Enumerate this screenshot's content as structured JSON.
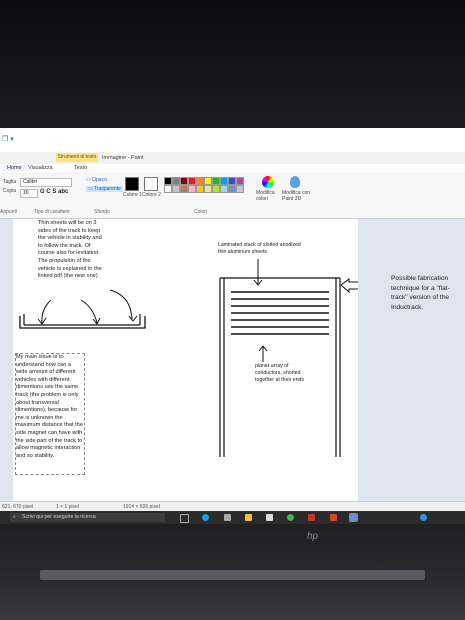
{
  "app": {
    "context_tab": "Strumenti di testo",
    "window_title": "Immagine - Paint",
    "tabs": [
      "Home",
      "Visualizza",
      "Testo"
    ]
  },
  "ribbon": {
    "font_name": "Calibri",
    "font_size": "10",
    "style_labels": "G C S abc",
    "opaque": "Opaco",
    "transparent": "Trasparente",
    "left_labels": [
      "Taglia",
      "Copia"
    ],
    "color1": "Colore 1",
    "color2": "Colore 2",
    "edit_colors": "Modifica colori",
    "paint3d": "Modifica con Paint 3D",
    "group_labels": [
      "Appunti",
      "Tipo di carattere",
      "Sfondo",
      "Colori"
    ],
    "palette": [
      "#000000",
      "#7f7f7f",
      "#880015",
      "#ed1c24",
      "#ff7f27",
      "#fff200",
      "#22b14c",
      "#00a2e8",
      "#3f48cc",
      "#a349a4",
      "#ffffff",
      "#c3c3c3",
      "#b97a57",
      "#ffaec9",
      "#ffc90e",
      "#efe4b0",
      "#b5e61d",
      "#99d9ea",
      "#7092be",
      "#c8bfe7"
    ]
  },
  "canvas": {
    "left_note": "Thin sheets will be on 3 sides of the track to keep the vehicle in stability and to follow the track. Of course also for levitation. The propulsion of the vehicle is explained in the linked pdf (the new one)",
    "issue_note": "My main issue is to understand how can a wide amount of different vehicles with different dimentions use the same track (the problem is only about transversal dimentions), because for me is unknown the maximum distance that the side magnet can have with the side part of the track to allow magnetic interaction and so stability.",
    "laminated_label": "Laminated stack of slotted anodized thin aluminum sheets",
    "planar_label": "planar array of conductors, shorted together at their ends",
    "fabrication_label": "Possible fabrication technique for a \"flat-track\" version of the Inductrack."
  },
  "status": {
    "position": "621, 670 pixel",
    "selection": "1 × 1 pixel",
    "size": "1914 × 826 pixel"
  },
  "taskbar": {
    "search_placeholder": "Scrivi qui per eseguire la ricerca"
  }
}
